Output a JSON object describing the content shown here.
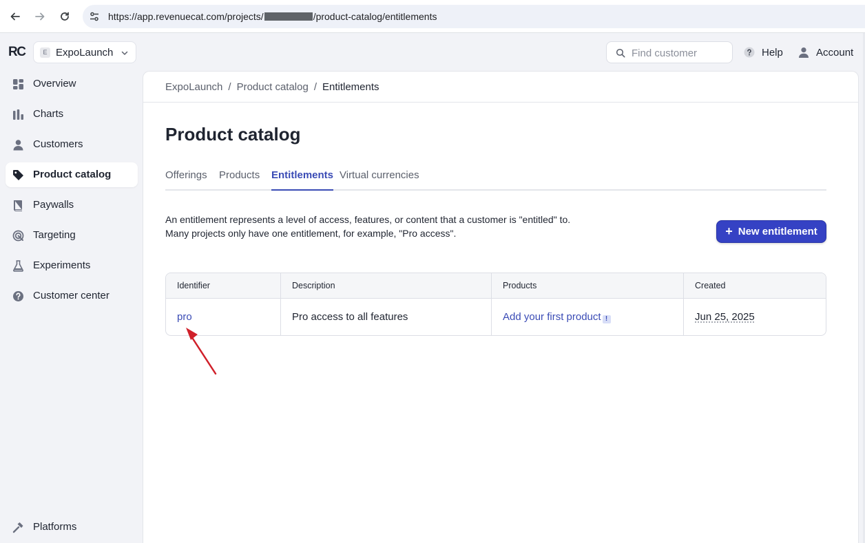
{
  "browser": {
    "url_prefix": "https://app.revenuecat.com/projects/",
    "url_suffix": "/product-catalog/entitlements"
  },
  "sidebar": {
    "logo": "RC",
    "project_badge": "E",
    "project_name": "ExpoLaunch",
    "items": [
      {
        "label": "Overview",
        "icon": "grid-icon"
      },
      {
        "label": "Charts",
        "icon": "bar-chart-icon"
      },
      {
        "label": "Customers",
        "icon": "person-icon"
      },
      {
        "label": "Product catalog",
        "icon": "tag-icon",
        "active": true
      },
      {
        "label": "Paywalls",
        "icon": "book-icon"
      },
      {
        "label": "Targeting",
        "icon": "target-icon"
      },
      {
        "label": "Experiments",
        "icon": "flask-icon"
      },
      {
        "label": "Customer center",
        "icon": "help-circle-icon"
      }
    ],
    "footer_item": {
      "label": "Platforms",
      "icon": "hammer-icon"
    }
  },
  "header": {
    "search_placeholder": "Find customer",
    "help_label": "Help",
    "account_label": "Account"
  },
  "main": {
    "breadcrumb": [
      "ExpoLaunch",
      "Product catalog",
      "Entitlements"
    ],
    "title": "Product catalog",
    "tabs": [
      {
        "label": "Offerings"
      },
      {
        "label": "Products"
      },
      {
        "label": "Entitlements",
        "active": true
      },
      {
        "label": "Virtual currencies"
      }
    ],
    "description_line1": "An entitlement represents a level of access, features, or content that a customer is \"entitled\" to.",
    "description_line2": "Many projects only have one entitlement, for example, \"Pro access\".",
    "new_button_label": "New entitlement"
  },
  "table": {
    "columns": [
      "Identifier",
      "Description",
      "Products",
      "Created"
    ],
    "rows": [
      {
        "identifier": "pro",
        "description": "Pro access to all features",
        "products": "Add your first product",
        "created": "Jun 25, 2025"
      }
    ]
  },
  "colors": {
    "accent": "#3542c4",
    "link": "#3a4bb5",
    "annotation": "#d0202a"
  }
}
